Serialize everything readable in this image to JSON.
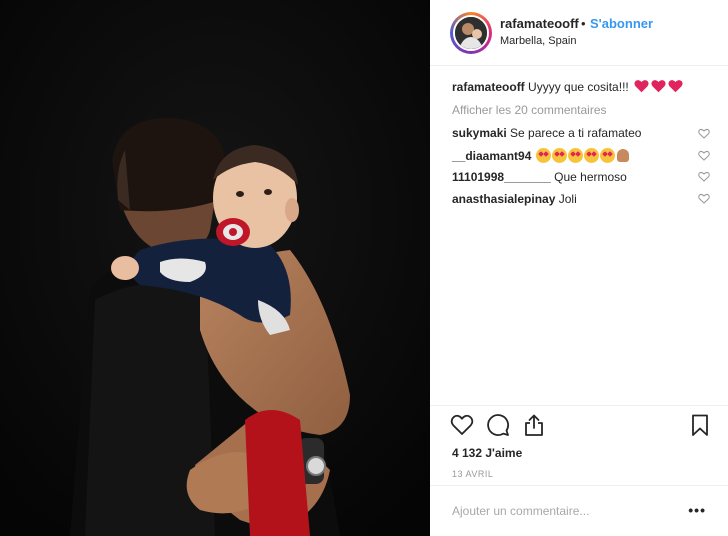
{
  "header": {
    "username": "rafamateooff",
    "separator": "•",
    "follow_label": "S'abonner",
    "location": "Marbella, Spain"
  },
  "caption": {
    "username": "rafamateooff",
    "text": "Uyyyy que cosita!!!",
    "emoji": [
      "heart-red",
      "heart-red",
      "heart-red"
    ]
  },
  "load_more": "Afficher les 20 commentaires",
  "comments": [
    {
      "username": "sukymaki",
      "text": "Se parece a ti rafamateo"
    },
    {
      "username": "__diaamant94",
      "text": "",
      "emoji": [
        "heart-eyes",
        "heart-eyes",
        "heart-eyes",
        "heart-eyes",
        "heart-eyes",
        "folded-hands"
      ]
    },
    {
      "username": "11101998_______",
      "text": "Que hermoso"
    },
    {
      "username": "anasthasialepinay",
      "text": "Joli"
    }
  ],
  "actions": {
    "icons": [
      "heart-outline-icon",
      "comment-icon",
      "share-icon",
      "bookmark-icon"
    ]
  },
  "likes": "4 132 J'aime",
  "date": "13 AVRIL",
  "add_comment": {
    "placeholder": "Ajouter un commentaire..."
  },
  "more_label": "•••",
  "colors": {
    "link_blue": "#3897f0",
    "text": "#262626",
    "muted": "#999999",
    "heart_red": "#e0245e",
    "divider": "#efefef"
  }
}
